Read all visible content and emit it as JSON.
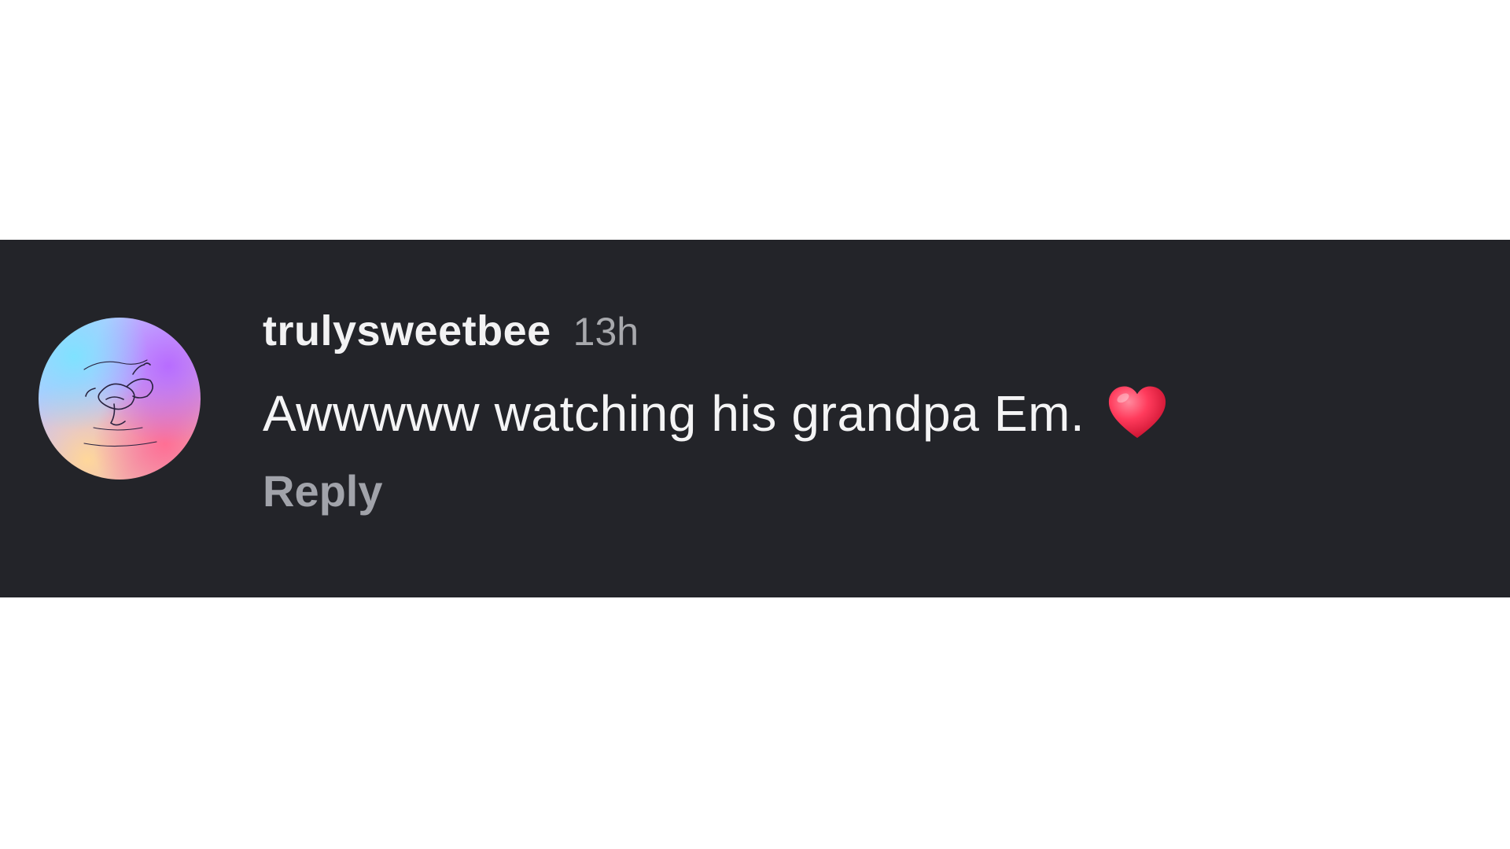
{
  "comment": {
    "username": "trulysweetbee",
    "timestamp": "13h",
    "text": "Awwwww watching his grandpa Em.",
    "emoji_icon": "red-heart-icon",
    "reply_label": "Reply"
  },
  "avatar": {
    "icon": "bee-logo-avatar"
  },
  "colors": {
    "band_background": "#232429",
    "page_background": "#ffffff",
    "username": "#f2f2f3",
    "timestamp": "#a8a9ad",
    "reply": "#a1a3aa",
    "heart": "#ff3b5c"
  }
}
